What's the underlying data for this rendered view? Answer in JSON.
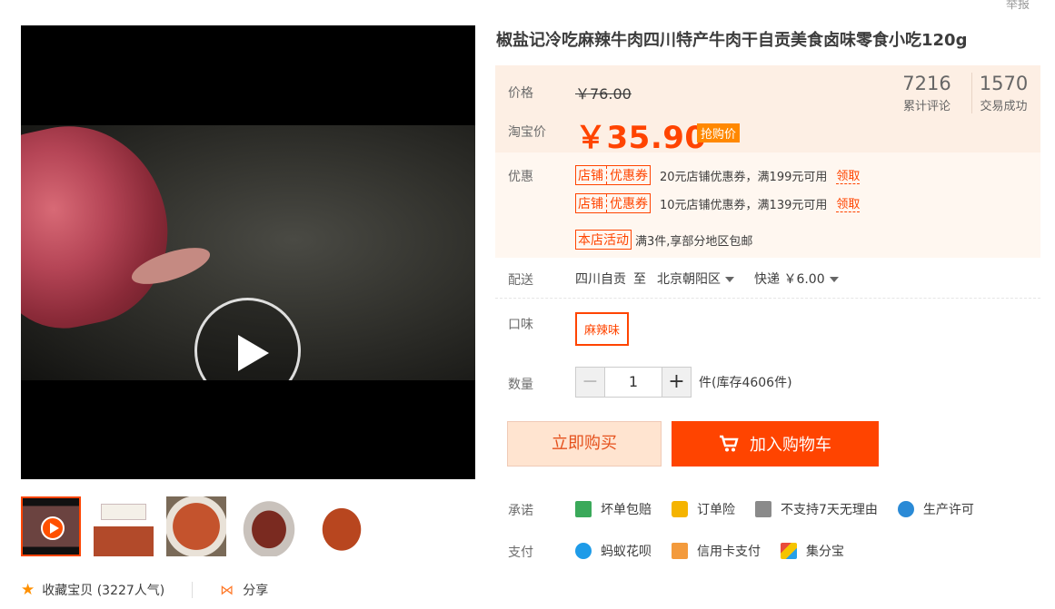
{
  "report_label": "举报",
  "product": {
    "title": "椒盐记冷吃麻辣牛肉四川特产牛肉干自贡美食卤味零食小吃120g"
  },
  "price": {
    "label": "价格",
    "original": "￥76.00",
    "taobao_label": "淘宝价",
    "current": "￥35.90",
    "tag": "抢购价"
  },
  "stats": {
    "reviews_count": "7216",
    "reviews_label": "累计评论",
    "trades_count": "1570",
    "trades_label": "交易成功"
  },
  "promotions": {
    "label": "优惠",
    "coupons": [
      {
        "tag_left": "店铺",
        "tag_right": "优惠券",
        "text": "20元店铺优惠券，满199元可用",
        "action": "领取"
      },
      {
        "tag_left": "店铺",
        "tag_right": "优惠券",
        "text": "10元店铺优惠券，满139元可用",
        "action": "领取"
      }
    ],
    "activity_tag": "本店活动",
    "activity_text": "满3件,享部分地区包邮"
  },
  "shipping": {
    "label": "配送",
    "from": "四川自贡",
    "to_word": "至",
    "destination": "北京朝阳区",
    "method": "快递 ￥6.00"
  },
  "flavor": {
    "label": "口味",
    "selected": "麻辣味"
  },
  "quantity": {
    "label": "数量",
    "minus": "−",
    "value": "1",
    "plus": "+",
    "stock": "件(库存4606件)"
  },
  "actions": {
    "buy_now": "立即购买",
    "add_cart": "加入购物车"
  },
  "promise": {
    "label": "承诺",
    "items": [
      "坏单包赔",
      "订单险",
      "不支持7天无理由",
      "生产许可"
    ]
  },
  "payment": {
    "label": "支付",
    "items": [
      "蚂蚁花呗",
      "信用卡支付",
      "集分宝"
    ]
  },
  "footer": {
    "collect": "收藏宝贝 (3227人气)",
    "share": "分享"
  },
  "colors": {
    "accent": "#ff4400",
    "price_bg": "#fdefe4",
    "promo_bg": "#fff7f0"
  }
}
